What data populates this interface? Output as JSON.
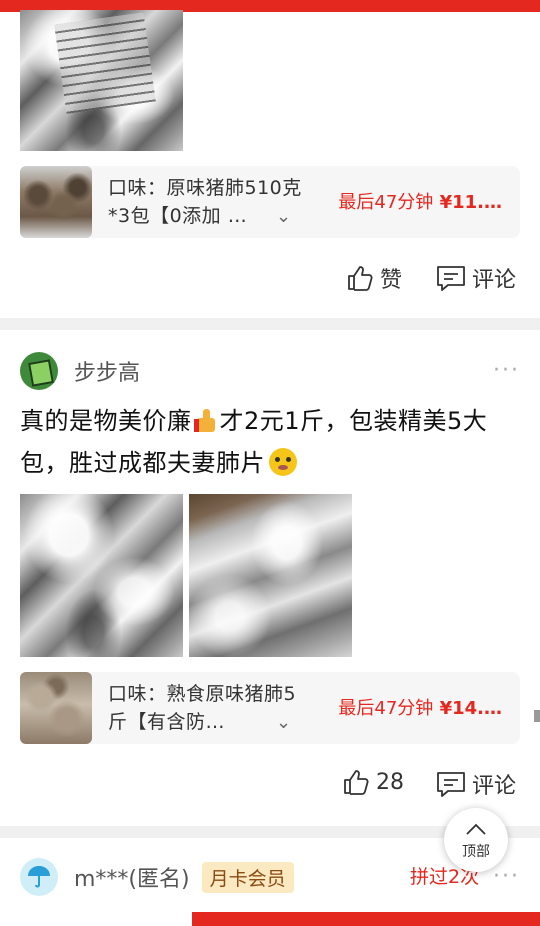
{
  "post1": {
    "product": {
      "title": "口味：原味猪肺510克*3包【0添加 …",
      "price_prefix": "最后47分钟",
      "price": "¥11.…"
    },
    "actions": {
      "like_label": "赞",
      "comment_label": "评论"
    }
  },
  "post2": {
    "username": "步步高",
    "text_part1": "真的是物美价廉",
    "text_part2": "才2元1斤，包装精美5大包，胜过成都夫妻肺片",
    "product": {
      "title": "口味：熟食原味猪肺5斤【有含防…",
      "price_prefix": "最后47分钟",
      "price": "¥14.…"
    },
    "actions": {
      "like_count": "28",
      "comment_label": "评论"
    }
  },
  "post3": {
    "username": "m***(匿名)",
    "badge": "月卡会员",
    "meta": "拼过2次"
  },
  "back_to_top": {
    "label": "顶部"
  },
  "more_label": "···",
  "colors": {
    "accent": "#e5281f",
    "badge_bg": "#fbe9c2",
    "card_bg": "#f6f6f6"
  }
}
